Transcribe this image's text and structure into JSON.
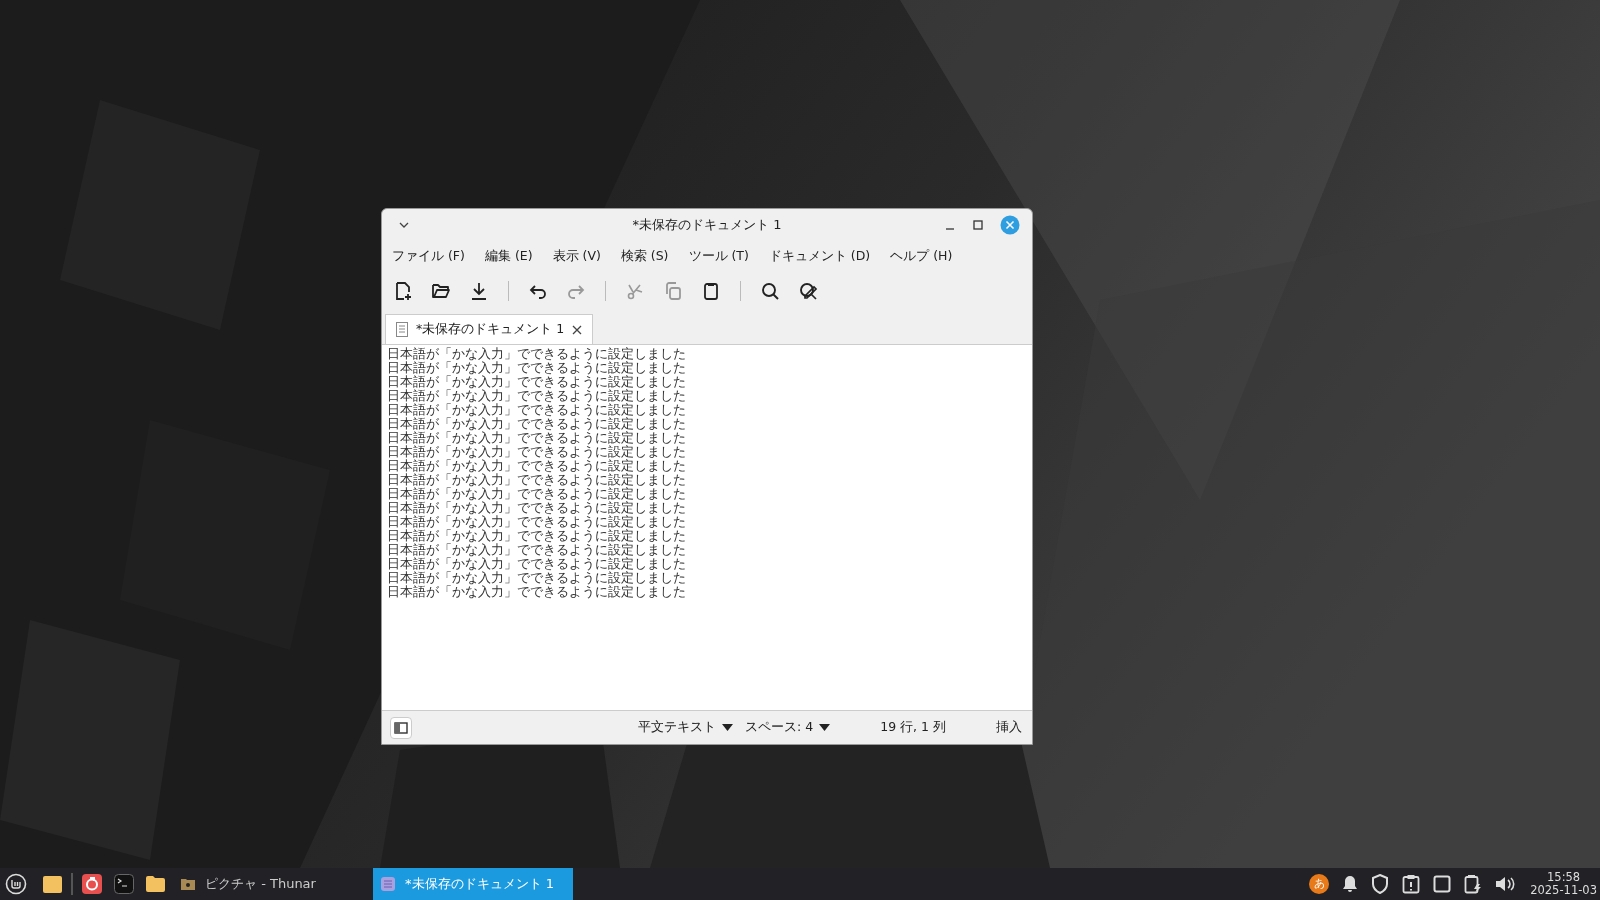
{
  "window": {
    "title": "*未保存のドキュメント 1"
  },
  "menu": [
    "ファイル (F)",
    "編集 (E)",
    "表示 (V)",
    "検索 (S)",
    "ツール (T)",
    "ドキュメント (D)",
    "ヘルプ (H)"
  ],
  "toolbar": [
    {
      "kind": "new",
      "disabled": false
    },
    {
      "kind": "open",
      "disabled": false
    },
    {
      "kind": "save",
      "disabled": false
    },
    {
      "kind": "sep"
    },
    {
      "kind": "undo",
      "disabled": false
    },
    {
      "kind": "redo",
      "disabled": true
    },
    {
      "kind": "sep"
    },
    {
      "kind": "cut",
      "disabled": true
    },
    {
      "kind": "copy",
      "disabled": true
    },
    {
      "kind": "paste",
      "disabled": false
    },
    {
      "kind": "sep"
    },
    {
      "kind": "find",
      "disabled": false
    },
    {
      "kind": "replace",
      "disabled": false
    }
  ],
  "tabs": [
    {
      "label": "*未保存のドキュメント 1",
      "selected": true
    }
  ],
  "lines": [
    "日本語が「かな入力」でできるように設定しました",
    "日本語が「かな入力」でできるように設定しました",
    "日本語が「かな入力」でできるように設定しました",
    "日本語が「かな入力」でできるように設定しました",
    "日本語が「かな入力」でできるように設定しました",
    "日本語が「かな入力」でできるように設定しました",
    "日本語が「かな入力」でできるように設定しました",
    "日本語が「かな入力」でできるように設定しました",
    "日本語が「かな入力」でできるように設定しました",
    "日本語が「かな入力」でできるように設定しました",
    "日本語が「かな入力」でできるように設定しました",
    "日本語が「かな入力」でできるように設定しました",
    "日本語が「かな入力」でできるように設定しました",
    "日本語が「かな入力」でできるように設定しました",
    "日本語が「かな入力」でできるように設定しました",
    "日本語が「かな入力」でできるように設定しました",
    "日本語が「かな入力」でできるように設定しました",
    "日本語が「かな入力」でできるように設定しました"
  ],
  "status_bar": {
    "filetype": "平文テキスト",
    "indent": "スペース: 4",
    "position": "19 行, 1 列",
    "mode": "挿入"
  },
  "taskbar": {
    "windows": [
      {
        "label": "ピクチャ - Thunar",
        "kind": "folder",
        "selected": false
      },
      {
        "label": "*未保存のドキュメント 1",
        "kind": "editor",
        "selected": true
      }
    ],
    "ime": "あ",
    "time": "15:58",
    "date": "2025-11-03"
  }
}
